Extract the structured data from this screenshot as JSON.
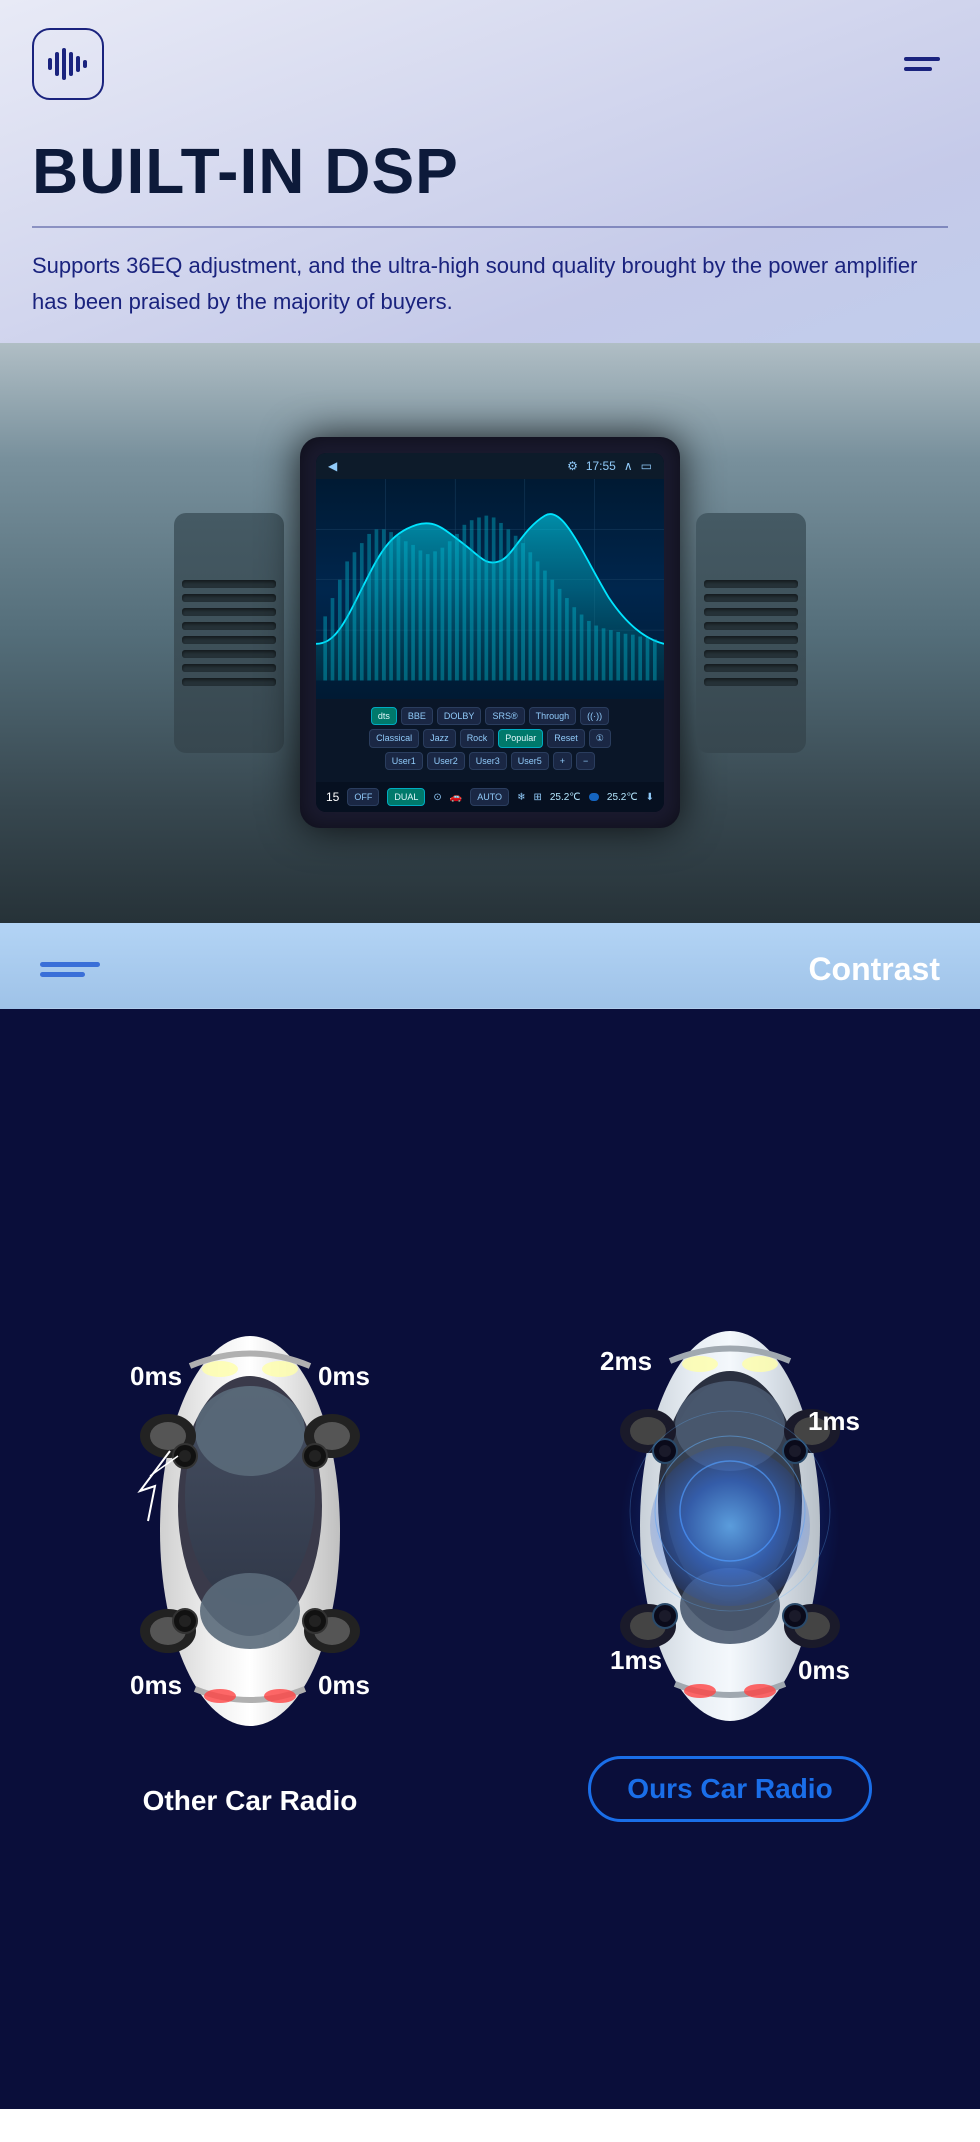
{
  "header": {
    "logo_alt": "Audio Logo",
    "menu_label": "Menu"
  },
  "hero": {
    "title": "BUILT-IN DSP",
    "divider": true,
    "subtitle": "Supports 36EQ adjustment, and the ultra-high sound quality brought by the power amplifier has been praised by the majority of buyers."
  },
  "screen": {
    "time": "17:55",
    "eq_label": "EQ Display",
    "controls": {
      "row1": [
        "dts",
        "BBE",
        "DOLBY",
        "SRS®",
        "Through",
        "((·))"
      ],
      "row2": [
        "Classical",
        "Jazz",
        "Rock",
        "Popular",
        "Reset",
        "①"
      ],
      "row3": [
        "User1",
        "User2",
        "User3",
        "User5",
        "+",
        "−"
      ],
      "bottom": [
        "OFF",
        "DUAL",
        "AUTO"
      ],
      "temp_left": "25.2℃",
      "temp_right": "25.2℃",
      "number": "15"
    }
  },
  "contrast": {
    "icon_lines": [
      60,
      45
    ],
    "label": "Contrast"
  },
  "comparison": {
    "other": {
      "car_label": "Other Car Radio",
      "delays": {
        "top_left": "0ms",
        "top_right": "0ms",
        "bottom_left": "0ms",
        "bottom_right": "0ms"
      }
    },
    "ours": {
      "car_label": "Ours Car Radio",
      "delays": {
        "top_left": "2ms",
        "top_right": "1ms",
        "bottom_left": "1ms",
        "bottom_right": "0ms"
      }
    }
  }
}
